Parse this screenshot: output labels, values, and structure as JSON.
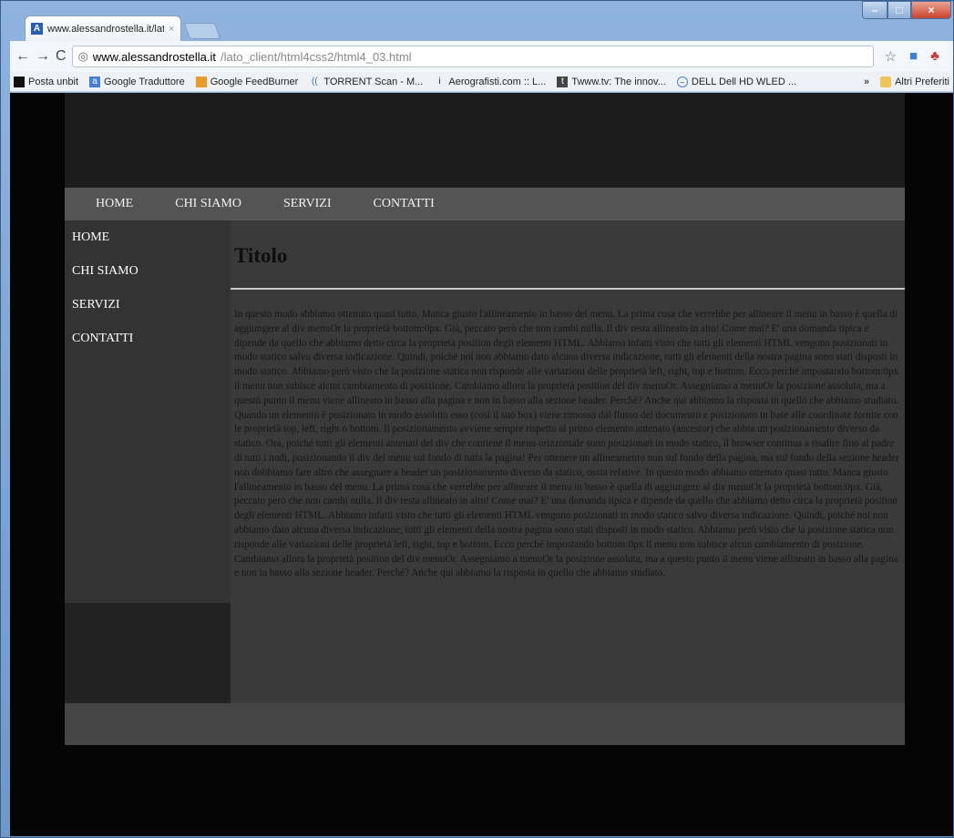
{
  "browser": {
    "tab_title": "www.alessandrostella.it/lat",
    "tab_favicon": "A",
    "url_host": "www.alessandrostella.it",
    "url_path": "/lato_client/html4css2/html4_03.html",
    "bookmarks": [
      {
        "icon": "bookmark-icon",
        "label": "Posta unbit"
      },
      {
        "icon": "translate-icon",
        "label": "Google Traduttore"
      },
      {
        "icon": "feedburner-icon",
        "label": "Google FeedBurner"
      },
      {
        "icon": "torrent-icon",
        "label": "TORRENT Scan - M..."
      },
      {
        "icon": "aerografo-icon",
        "label": "Aerografisti.com :: L..."
      },
      {
        "icon": "twww-icon",
        "label": "Twww.tv: The innov..."
      },
      {
        "icon": "dell-icon",
        "label": "DELL Dell HD WLED ..."
      }
    ],
    "bookmarks_more": "»",
    "other_bookmarks": "Altri Preferiti"
  },
  "page": {
    "topnav": [
      "HOME",
      "CHI SIAMO",
      "SERVIZI",
      "CONTATTI"
    ],
    "sidebar": [
      "HOME",
      "CHI SIAMO",
      "SERVIZI",
      "CONTATTI"
    ],
    "title": "Titolo",
    "body": "In questo modo abbiamo ottenuto quasi tutto. Manca giusto l'allineamento in basso del menu. La prima cosa che verrebbe per allineare il menu in basso è quella di aggiungere al div menuOr la proprietà bottom:0px. Già, peccato però che non cambi nulla. Il div resta allineato in alto! Come mai? E' una domanda tipica e dipende da quello che abbiamo detto circa la proprietà position degli elementi HTML. Abbiamo infatti visto che tutti gli elementi HTML vengono posizionati in modo statico salvo diversa indicazione. Quindi, poiché noi non abbiamo dato alcuna diversa indicazione, tutti gli elementi della nostra pagina sono stati disposti in modo statico. Abbiamo però visto che la posizione statica non risponde alle variazioni delle proprietà left, right, top e bottom. Ecco perché impostando bottom:0px il menu non subisce alcun cambiamento di posizione. Cambiamo allora la proprietà position del div menuOr. Assegniamo a menuOr la posizione assoluta, ma a questo punto il menu viene allineato in basso alla pagina e non in basso alla sezione header. Perché? Anche qui abbiamo la risposta in quello che abbiamo studiato. Quando un elemento è posizionato in modo assoluto esso (così il suo box) viene rimosso dal flusso del documento e posizionato in base alle coordinate fornite con le proprietà top, left, right o bottom. Il posizionamento avviene sempre rispetto al primo elemento antenato (ancestor) che abbia un posizionamento diverso da statico. Ora, poiché tutti gli elementi antenati del div che contiene il menu orizzontale sono posizionati in modo statico, il browser continua a risalire fino al padre di tutti i nodi, posizionando il div del menu sul fondo di tutta la pagina! Per ottenere un allineamento non sul fondo della pagina, ma sul fondo della sezione header non dobbiamo fare altro che assegnare a header un posizionamento diverso da statico, ossia relative. In questo modo abbiamo ottenuto quasi tutto. Manca giusto l'allineamento in basso del menu. La prima cosa che verrebbe per allineare il menu in basso è quella di aggiungere al div menuOr la proprietà bottom:0px. Già, peccato però che non cambi nulla. Il div resta allineato in alto! Come mai? E' una domanda tipica e dipende da quello che abbiamo detto circa la proprietà position degli elementi HTML. Abbiamo infatti visto che tutti gli elementi HTML vengono posizionati in modo statico salvo diversa indicazione. Quindi, poiché noi non abbiamo dato alcuna diversa indicazione, tutti gli elementi della nostra pagina sono stati disposti in modo statico. Abbiamo però visto che la posizione statica non risponde alle variazioni delle proprietà left, right, top e bottom. Ecco perché impostando bottom:0px il menu non subisce alcun cambiamento di posizione. Cambiamo allora la proprietà position del div menuOr. Assegniamo a menuOr la posizione assoluta, ma a questo punto il menu viene allineato in basso alla pagina e non in basso alla sezione header. Perché? Anche qui abbiamo la risposta in quello che abbiamo studiato."
  },
  "colors": {
    "page_bg": "#050505",
    "nav_bg": "#545454",
    "sidebar_bg": "#333333",
    "content_bg": "#3a3a3a"
  }
}
